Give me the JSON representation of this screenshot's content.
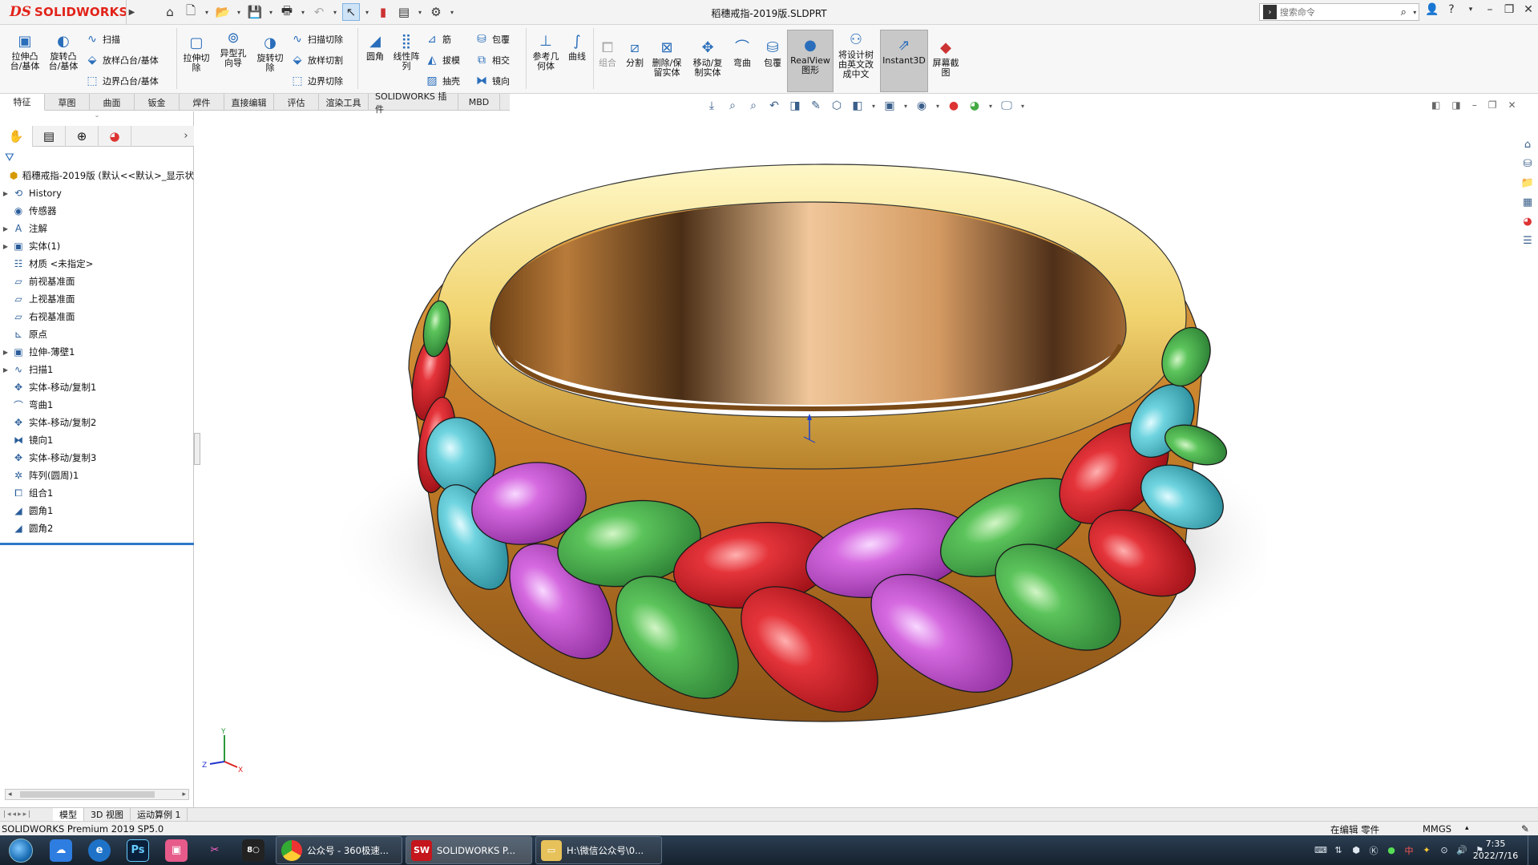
{
  "app": {
    "logo_ds": "DS",
    "logo_text": "SOLIDWORKS",
    "document_title": "稻穗戒指-2019版.SLDPRT",
    "search_placeholder": "搜索命令"
  },
  "ribbon": {
    "extrude_boss": "拉伸凸\n台/基体",
    "revolve_boss": "旋转凸\n台/基体",
    "sweep": "扫描",
    "loft_boss": "放样凸台/基体",
    "boundary_boss": "边界凸台/基体",
    "extrude_cut": "拉伸切\n除",
    "hole_wizard": "异型孔\n向导",
    "revolve_cut": "旋转切\n除",
    "sweep_cut": "扫描切除",
    "loft_cut": "放样切割",
    "boundary_cut": "边界切除",
    "fillet": "圆角",
    "linear_pattern": "线性阵\n列",
    "rib": "筋",
    "draft": "拔模",
    "shell": "抽壳",
    "wrap": "包覆",
    "intersect": "相交",
    "mirror": "镜向",
    "reference_geometry": "参考几\n何体",
    "curves": "曲线",
    "combine": "组合",
    "split": "分割",
    "delete_keep_body": "删除/保\n留实体",
    "move_copy_body": "移动/复\n制实体",
    "flex": "弯曲",
    "wrap2": "包覆",
    "realview": "RealView\n图形",
    "translate_tree": "将设计树\n由英文改\n成中文",
    "instant3d": "Instant3D",
    "screen_capture": "屏幕截\n图"
  },
  "tabs": [
    "特征",
    "草图",
    "曲面",
    "钣金",
    "焊件",
    "直接编辑",
    "评估",
    "渲染工具",
    "SOLIDWORKS 插件",
    "MBD"
  ],
  "feature_tree": {
    "root": "稻穗戒指-2019版  (默认<<默认>_显示状",
    "items": [
      {
        "label": "History",
        "expandable": true,
        "icon": "history-icon"
      },
      {
        "label": "传感器",
        "expandable": false,
        "icon": "sensor-icon"
      },
      {
        "label": "注解",
        "expandable": true,
        "icon": "annotation-icon"
      },
      {
        "label": "实体(1)",
        "expandable": true,
        "icon": "solid-bodies-icon"
      },
      {
        "label": "材质 <未指定>",
        "expandable": false,
        "icon": "material-icon"
      },
      {
        "label": "前视基准面",
        "expandable": false,
        "icon": "plane-icon"
      },
      {
        "label": "上视基准面",
        "expandable": false,
        "icon": "plane-icon"
      },
      {
        "label": "右视基准面",
        "expandable": false,
        "icon": "plane-icon"
      },
      {
        "label": "原点",
        "expandable": false,
        "icon": "origin-icon"
      },
      {
        "label": "拉伸-薄壁1",
        "expandable": true,
        "icon": "extrude-icon"
      },
      {
        "label": "扫描1",
        "expandable": true,
        "icon": "sweep-icon"
      },
      {
        "label": "实体-移动/复制1",
        "expandable": false,
        "icon": "move-body-icon"
      },
      {
        "label": "弯曲1",
        "expandable": false,
        "icon": "flex-icon"
      },
      {
        "label": "实体-移动/复制2",
        "expandable": false,
        "icon": "move-body-icon"
      },
      {
        "label": "镜向1",
        "expandable": false,
        "icon": "mirror-icon"
      },
      {
        "label": "实体-移动/复制3",
        "expandable": false,
        "icon": "move-body-icon"
      },
      {
        "label": "阵列(圆周)1",
        "expandable": false,
        "icon": "circular-pattern-icon"
      },
      {
        "label": "组合1",
        "expandable": false,
        "icon": "combine-icon"
      },
      {
        "label": "圆角1",
        "expandable": false,
        "icon": "fillet-icon"
      },
      {
        "label": "圆角2",
        "expandable": false,
        "icon": "fillet-icon"
      }
    ]
  },
  "model_tabs": [
    "模型",
    "3D 视图",
    "运动算例 1"
  ],
  "status": {
    "product": "SOLIDWORKS Premium 2019 SP5.0",
    "state": "在编辑 零件",
    "units": "MMGS"
  },
  "taskbar": {
    "tasks": [
      "公众号 - 360极速...",
      "SOLIDWORKS P...",
      "H:\\微信公众号\\0..."
    ],
    "time": "7:35",
    "date": "2022/7/16"
  },
  "triad": {
    "x": "X",
    "y": "Y",
    "z": "Z"
  },
  "colors": {
    "gold": "#d9a441",
    "red": "#d9232b",
    "green": "#4fbb55",
    "pink": "#c85ad6",
    "cyan": "#5ccbd6",
    "brand": "#e2231a"
  }
}
